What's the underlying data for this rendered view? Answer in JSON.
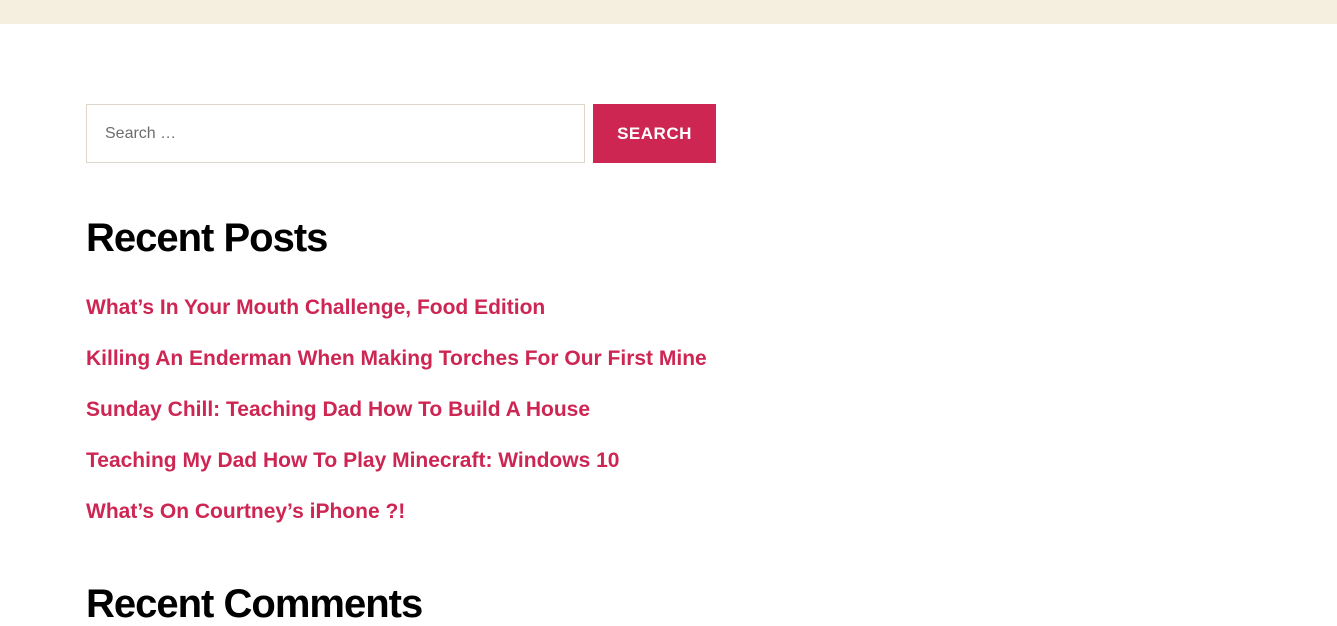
{
  "search": {
    "placeholder": "Search …",
    "button_label": "SEARCH"
  },
  "recent_posts": {
    "title": "Recent Posts",
    "items": [
      {
        "label": "What’s In Your Mouth Challenge, Food Edition"
      },
      {
        "label": "Killing An Enderman When Making Torches For Our First Mine"
      },
      {
        "label": "Sunday Chill: Teaching Dad How To Build A House"
      },
      {
        "label": "Teaching My Dad How To Play Minecraft: Windows 10"
      },
      {
        "label": "What’s On Courtney’s iPhone ?!"
      }
    ]
  },
  "recent_comments": {
    "title": "Recent Comments"
  },
  "colors": {
    "accent": "#cd2653",
    "top_strip": "#f5efe0",
    "input_border": "#dcd7ca"
  }
}
